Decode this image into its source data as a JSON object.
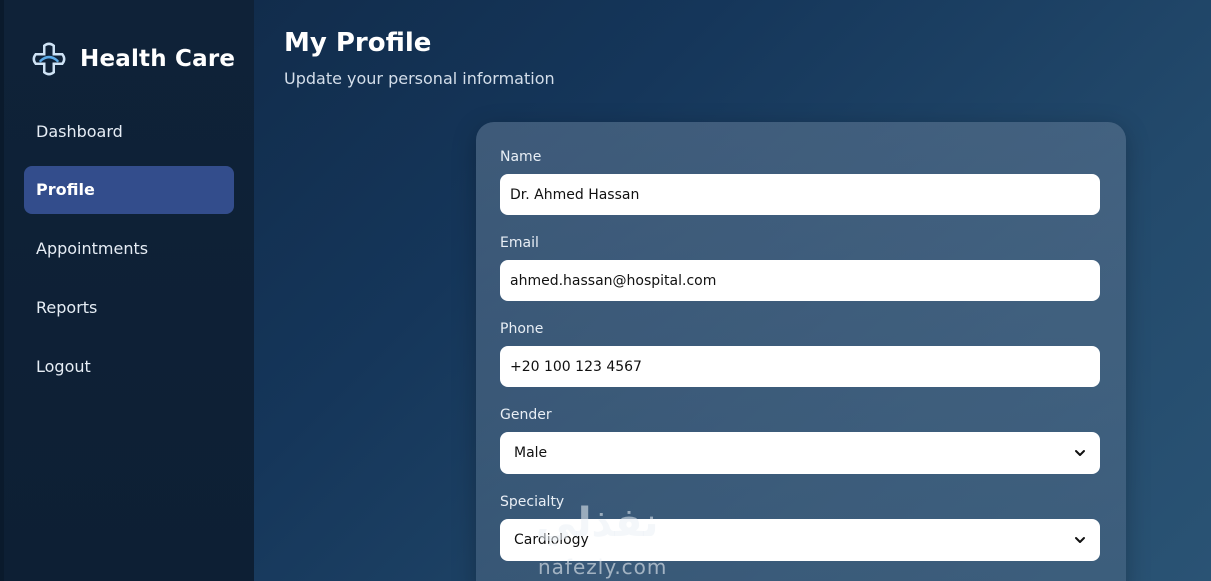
{
  "brand": {
    "name": "Health Care",
    "icon": "medical-cross-icon"
  },
  "sidebar": {
    "items": [
      {
        "label": "Dashboard",
        "active": false
      },
      {
        "label": "Profile",
        "active": true
      },
      {
        "label": "Appointments",
        "active": false
      },
      {
        "label": "Reports",
        "active": false
      },
      {
        "label": "Logout",
        "active": false
      }
    ]
  },
  "header": {
    "title": "My Profile",
    "subtitle": "Update your personal information"
  },
  "form": {
    "name": {
      "label": "Name",
      "value": "Dr. Ahmed Hassan"
    },
    "email": {
      "label": "Email",
      "value": "ahmed.hassan@hospital.com"
    },
    "phone": {
      "label": "Phone",
      "value": "+20 100 123 4567"
    },
    "gender": {
      "label": "Gender",
      "value": "Male"
    },
    "specialty": {
      "label": "Specialty",
      "value": "Cardiology"
    }
  },
  "watermark": {
    "arabic": "نفذلي",
    "latin": "nafezly.com"
  },
  "colors": {
    "active_nav": "#334d8c",
    "sidebar_bg": "#0f2238",
    "card_bg": "#4f6b88"
  }
}
